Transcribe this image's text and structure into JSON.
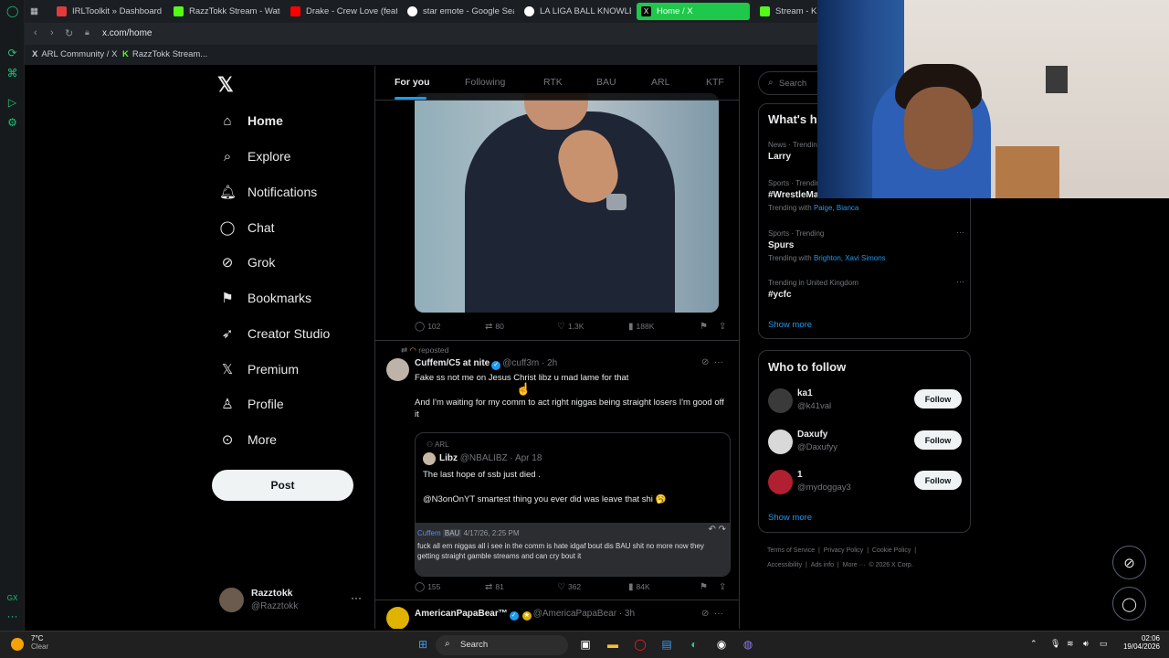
{
  "browser": {
    "tabs": [
      {
        "label": "IRLToolkit » Dashboard",
        "color": "#e23b3b"
      },
      {
        "label": "RazzTokk Stream - Watch",
        "color": "#53fc18"
      },
      {
        "label": "Drake - Crew Love (feat.",
        "color": "#ff0000"
      },
      {
        "label": "star emote - Google Search",
        "color": "#ffffff"
      },
      {
        "label": "LA LIGA BALL KNOWLEDGE",
        "color": "#ffffff"
      },
      {
        "label": "Home / X",
        "color": "#000000"
      },
      {
        "label": "Stream - Kick",
        "color": "#53fc18"
      }
    ],
    "url": "x.com/home",
    "bookmarks": [
      "ARL Community / X",
      "RazzTokk Stream..."
    ]
  },
  "sidebar": {
    "items": [
      {
        "label": "Home",
        "icon": "home-icon",
        "glyph": "⌂"
      },
      {
        "label": "Explore",
        "icon": "search-icon",
        "glyph": "⌕"
      },
      {
        "label": "Notifications",
        "icon": "bell-icon",
        "glyph": "🔔︎"
      },
      {
        "label": "Chat",
        "icon": "chat-icon",
        "glyph": "◯"
      },
      {
        "label": "Grok",
        "icon": "grok-icon",
        "glyph": "⊘"
      },
      {
        "label": "Bookmarks",
        "icon": "bookmark-icon",
        "glyph": "⚑"
      },
      {
        "label": "Creator Studio",
        "icon": "rocket-icon",
        "glyph": "➶"
      },
      {
        "label": "Premium",
        "icon": "x-icon",
        "glyph": "𝕏"
      },
      {
        "label": "Profile",
        "icon": "person-icon",
        "glyph": "♙"
      },
      {
        "label": "More",
        "icon": "more-circle-icon",
        "glyph": "⊙"
      }
    ],
    "post_label": "Post",
    "account": {
      "name": "Razztokk",
      "handle": "@Razztokk",
      "more": "···"
    }
  },
  "feed": {
    "tabs": [
      "For you",
      "Following",
      "RTK",
      "BAU",
      "ARL",
      "KTF"
    ],
    "first_post_stats": {
      "replies": "102",
      "reposts": "80",
      "likes": "1.3K",
      "views": "188K"
    },
    "repost_label": "reposted",
    "post2": {
      "name": "Cuffem/C5 at nite",
      "handle": "@cuff3m · 2h",
      "text1": "Fake ss not me on Jesus Christ libz u mad lame for that",
      "text2": "And I'm waiting for my comm to act right niggas being straight losers I'm good off it",
      "quote": {
        "community": "ARL",
        "name": "Libz",
        "handle": "@NBALIBZ · Apr 18",
        "text1": "The last hope of ssb just died .",
        "text2": "@N3onOnYT smartest thing you ever did was leave that shi 🥱",
        "chat_user": "Cuffem",
        "chat_tag": "BAU",
        "chat_time": "4/17/26, 2:25 PM",
        "chat_text": "fuck all em niggas all i see in the comm is hate idgaf bout dis BAU shit no more now they getting straight gamble streams and can cry bout it"
      },
      "stats": {
        "replies": "155",
        "reposts": "81",
        "likes": "362",
        "views": "84K"
      }
    },
    "post3": {
      "name": "AmericanPapaBear™",
      "handle": "@AmericaPapaBear · 3h"
    }
  },
  "right": {
    "search_placeholder": "Search",
    "whats_happening": "What's h",
    "trends": [
      {
        "cat": "News · Trending",
        "title": "Larry",
        "with": "",
        "names": ""
      },
      {
        "cat": "Sports · Trending",
        "title": "#WrestleMa",
        "with": "Trending with",
        "names": "Paige, Bianca"
      },
      {
        "cat": "Sports · Trending",
        "title": "Spurs",
        "with": "Trending with",
        "names": "Brighton, Xavi Simons"
      },
      {
        "cat": "Trending in United Kingdom",
        "title": "#ycfc",
        "with": "",
        "names": ""
      }
    ],
    "show_more": "Show more",
    "who_to_follow": "Who to follow",
    "follow_label": "Follow",
    "suggestions": [
      {
        "name": "ka1",
        "handle": "@k41val"
      },
      {
        "name": "Daxufy",
        "handle": "@Daxufyy"
      },
      {
        "name": "1",
        "handle": "@mydoggay3"
      }
    ],
    "footer_line1": [
      "Terms of Service",
      "|",
      "Privacy Policy",
      "|",
      "Cookie Policy",
      "|"
    ],
    "footer_line2": [
      "Accessibility",
      "|",
      "Ads info",
      "|",
      "More ···",
      "© 2026 X Corp."
    ]
  },
  "taskbar": {
    "temp": "7°C",
    "condition": "Clear",
    "search": "Search",
    "time": "02:06",
    "date": "19/04/2026"
  }
}
